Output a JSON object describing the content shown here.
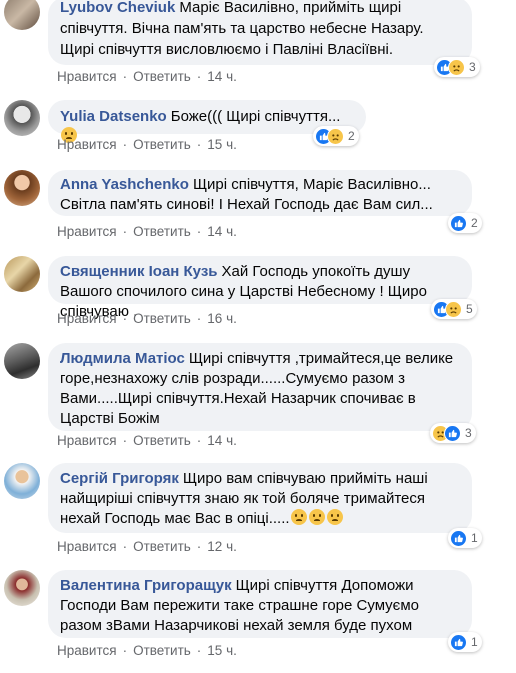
{
  "actions": {
    "like": "Нравится",
    "reply": "Ответить",
    "dot": "·"
  },
  "comments": [
    {
      "author": "Lyubov Cheviuk",
      "text": "Маріє Василівно, прийміть щирі співчуття. Вічна пам'ять та царство небесне Назару. Щирі співчуття висловлюємо і Павліні Власіївні.",
      "time": "14 ч.",
      "reactions": "3",
      "reaction_types": [
        "like-icon",
        "sad-icon"
      ]
    },
    {
      "author": "Yulia Datsenko",
      "text": "Боже((( Щирі співчуття...",
      "emoji_count": 1,
      "time": "15 ч.",
      "reactions": "2",
      "reaction_types": [
        "like-icon",
        "sad-icon"
      ]
    },
    {
      "author": "Anna Yashchenko",
      "text": "Щирі співчуття, Маріє Василівно... Світла пам'ять синові! І Нехай Господь дає Вам сил...",
      "time": "14 ч.",
      "reactions": "2",
      "reaction_types": [
        "like-icon"
      ]
    },
    {
      "author": "Священник Іоан Кузь",
      "text": "Хай Господь упокоїть душу Вашого спочилого сина у Царстві Небесному ! Щиро співчуваю .",
      "time": "16 ч.",
      "reactions": "5",
      "reaction_types": [
        "like-icon",
        "sad-icon"
      ]
    },
    {
      "author": "Людмила Матіос",
      "text": "Щирі співчуття ,тримайтеся,це велике горе,незнахожу слів розради......Сумуємо разом з Вами.....Щирі співчуття.Нехай Назарчик спочиває в Царстві Божім",
      "time": "14 ч.",
      "reactions": "3",
      "reaction_types": [
        "sad-icon",
        "like-icon"
      ]
    },
    {
      "author": "Сергій Григоряк",
      "text": "Щиро вам співчуваю прийміть наші найщиріші співчуття знаю як той боляче тримайтеся нехай Господь має Вас в опіці.....",
      "emoji_count": 3,
      "time": "12 ч.",
      "reactions": "1",
      "reaction_types": [
        "like-icon"
      ]
    },
    {
      "author": "Валентина Григоращук",
      "text": "Щирі співчуття Допоможи Господи Вам пережити таке страшне горе Сумуємо разом зВами Назарчикові нехай земля буде пухом",
      "time": "15 ч.",
      "reactions": "1",
      "reaction_types": [
        "like-icon"
      ]
    }
  ],
  "colors": {
    "author": "#385898",
    "bubble": "#f0f2f5",
    "meta": "#65676b",
    "like": "#1877f2",
    "sad": "#f7c54a"
  }
}
